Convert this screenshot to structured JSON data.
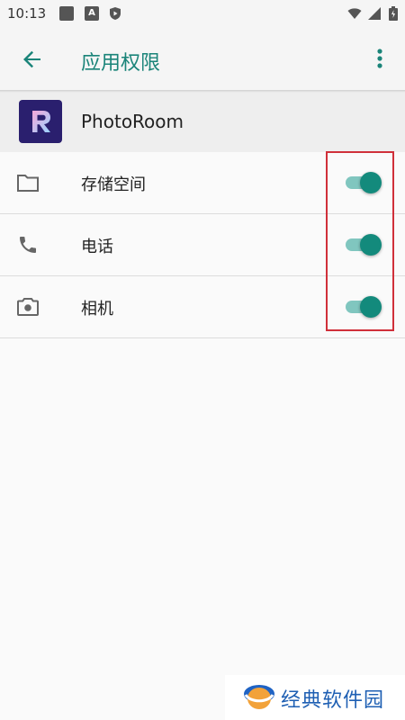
{
  "status_bar": {
    "time": "10:13",
    "icons": [
      "square-notification-icon",
      "a-notification-icon",
      "shield-play-icon",
      "wifi-icon",
      "cell-signal-icon",
      "battery-icon"
    ]
  },
  "app_bar": {
    "title": "应用权限",
    "back_icon": "arrow-back-icon",
    "more_icon": "more-vert-icon",
    "accent_color": "#1a8479"
  },
  "app": {
    "name": "PhotoRoom",
    "logo_letter": "R"
  },
  "permissions": [
    {
      "label": "存储空间",
      "icon": "folder-icon",
      "enabled": true
    },
    {
      "label": "电话",
      "icon": "phone-icon",
      "enabled": true
    },
    {
      "label": "相机",
      "icon": "camera-icon",
      "enabled": true
    }
  ],
  "watermark": {
    "text": "经典软件园"
  },
  "colors": {
    "toggle_on_thumb": "#138a7c",
    "toggle_on_track": "#80c6bf",
    "highlight_border": "#d0303a"
  }
}
